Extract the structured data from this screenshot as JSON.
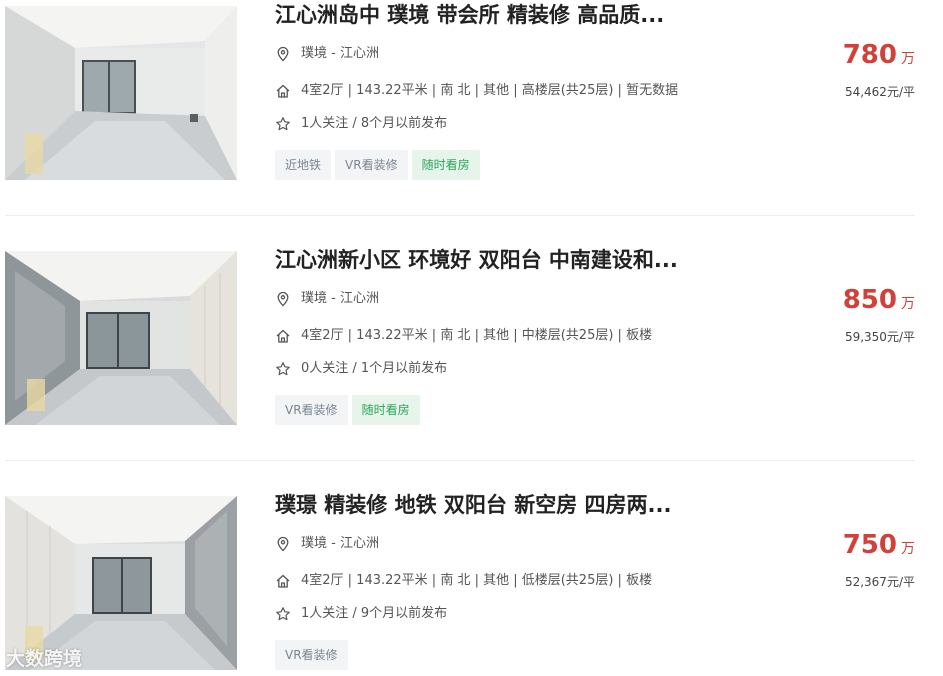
{
  "listings": [
    {
      "title": "江心洲岛中 璞境 带会所 精装修 高品质...",
      "community": "璞境",
      "area": "江心洲",
      "house_info": "4室2厅 | 143.22平米 | 南 北 | 其他 | 高楼层(共25层) | 暂无数据",
      "follow_info": "1人关注 / 8个月以前发布",
      "tags": [
        {
          "label": "近地铁",
          "style": "gray"
        },
        {
          "label": "VR看装修",
          "style": "gray"
        },
        {
          "label": "随时看房",
          "style": "green"
        }
      ],
      "total_price": "780",
      "price_unit": "万",
      "unit_price": "54,462元/平"
    },
    {
      "title": "江心洲新小区 环境好 双阳台 中南建设和...",
      "community": "璞境",
      "area": "江心洲",
      "house_info": "4室2厅 | 143.22平米 | 南 北 | 其他 | 中楼层(共25层) | 板楼",
      "follow_info": "0人关注 / 1个月以前发布",
      "tags": [
        {
          "label": "VR看装修",
          "style": "gray"
        },
        {
          "label": "随时看房",
          "style": "green"
        }
      ],
      "total_price": "850",
      "price_unit": "万",
      "unit_price": "59,350元/平"
    },
    {
      "title": "璞璟 精装修 地铁 双阳台 新空房 四房两...",
      "community": "璞境",
      "area": "江心洲",
      "house_info": "4室2厅 | 143.22平米 | 南 北 | 其他 | 低楼层(共25层) | 板楼",
      "follow_info": "1人关注 / 9个月以前发布",
      "tags": [
        {
          "label": "VR看装修",
          "style": "gray"
        }
      ],
      "total_price": "750",
      "price_unit": "万",
      "unit_price": "52,367元/平"
    }
  ],
  "location_separator": " - ",
  "icons": {
    "location": "location-pin-icon",
    "house": "house-icon",
    "follow": "star-icon"
  },
  "colors": {
    "price": "#d0413a",
    "tag_gray_bg": "#f2f4f6",
    "tag_green_bg": "#e6f4ea",
    "tag_green_text": "#2ca45a"
  },
  "watermark": "大数跨境"
}
